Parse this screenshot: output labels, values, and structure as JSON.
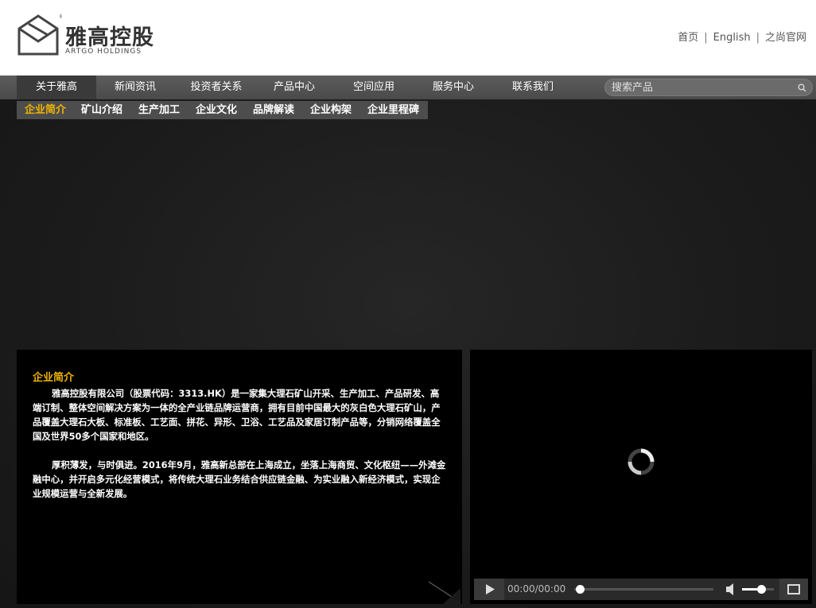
{
  "brand": {
    "name_cn": "雅高控股",
    "name_en": "ARTGO HOLDINGS",
    "registered_mark": "®"
  },
  "top_links": [
    {
      "label": "首页"
    },
    {
      "label": "English"
    },
    {
      "label": "之尚官网"
    }
  ],
  "nav": {
    "items": [
      {
        "label": "关于雅高",
        "active": true
      },
      {
        "label": "新闻资讯"
      },
      {
        "label": "投资者关系"
      },
      {
        "label": "产品中心"
      },
      {
        "label": "空间应用"
      },
      {
        "label": "服务中心"
      },
      {
        "label": "联系我们"
      }
    ],
    "search_placeholder": "搜索产品",
    "search_icon": "search-icon"
  },
  "subnav": {
    "items": [
      {
        "label": "企业简介",
        "active": true
      },
      {
        "label": "矿山介绍"
      },
      {
        "label": "生产加工"
      },
      {
        "label": "企业文化"
      },
      {
        "label": "品牌解读"
      },
      {
        "label": "企业构架"
      },
      {
        "label": "企业里程碑"
      }
    ]
  },
  "intro": {
    "title": "企业简介",
    "paragraph_1": "雅高控股有限公司（股票代码：3313.HK）是一家集大理石矿山开采、生产加工、产品研发、高端订制、整体空间解决方案为一体的全产业链品牌运营商，拥有目前中国最大的灰白色大理石矿山，产品覆盖大理石大板、标准板、工艺面、拼花、异形、卫浴、工艺品及家居订制产品等，分销网络覆盖全国及世界50多个国家和地区。",
    "paragraph_2": "厚积薄发，与时俱进。2016年9月，雅高新总部在上海成立，坐落上海商贸、文化枢纽——外滩金融中心，并开启多元化经营模式，将传统大理石业务结合供应链金融、为实业融入新经济模式，实现企业规模运营与全新发展。"
  },
  "video": {
    "time": "00:00/00:00",
    "progress": 0,
    "volume": 0.6
  },
  "colors": {
    "accent": "#f0b400",
    "nav_bg": "#555555",
    "panel_bg": "#000000"
  }
}
